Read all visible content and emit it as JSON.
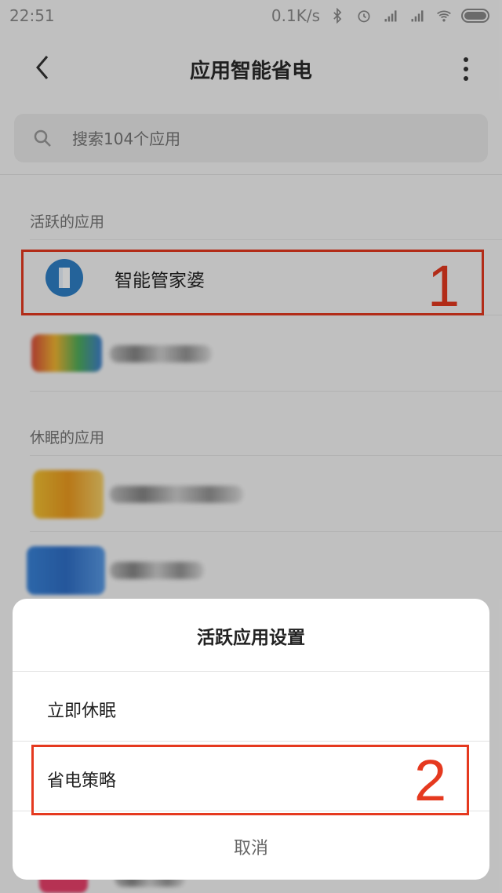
{
  "status_bar": {
    "time": "22:51",
    "speed": "0.1K/s",
    "icons": [
      "bluetooth-icon",
      "alarm-icon",
      "signal-icon",
      "signal-icon",
      "wifi-icon",
      "battery-icon"
    ]
  },
  "header": {
    "title": "应用智能省电",
    "back_icon": "back-arrow-icon",
    "more_icon": "more-vertical-icon"
  },
  "search": {
    "placeholder": "搜索104个应用",
    "icon": "search-icon"
  },
  "sections": {
    "active": "活跃的应用",
    "sleeping": "休眠的应用"
  },
  "apps": {
    "active": [
      {
        "name": "智能管家婆",
        "icon": "app-icon"
      }
    ]
  },
  "annotations": {
    "label1": "1",
    "label2": "2",
    "color": "#e5391f"
  },
  "dialog": {
    "title": "活跃应用设置",
    "options": [
      "立即休眠",
      "省电策略"
    ],
    "cancel": "取消"
  }
}
